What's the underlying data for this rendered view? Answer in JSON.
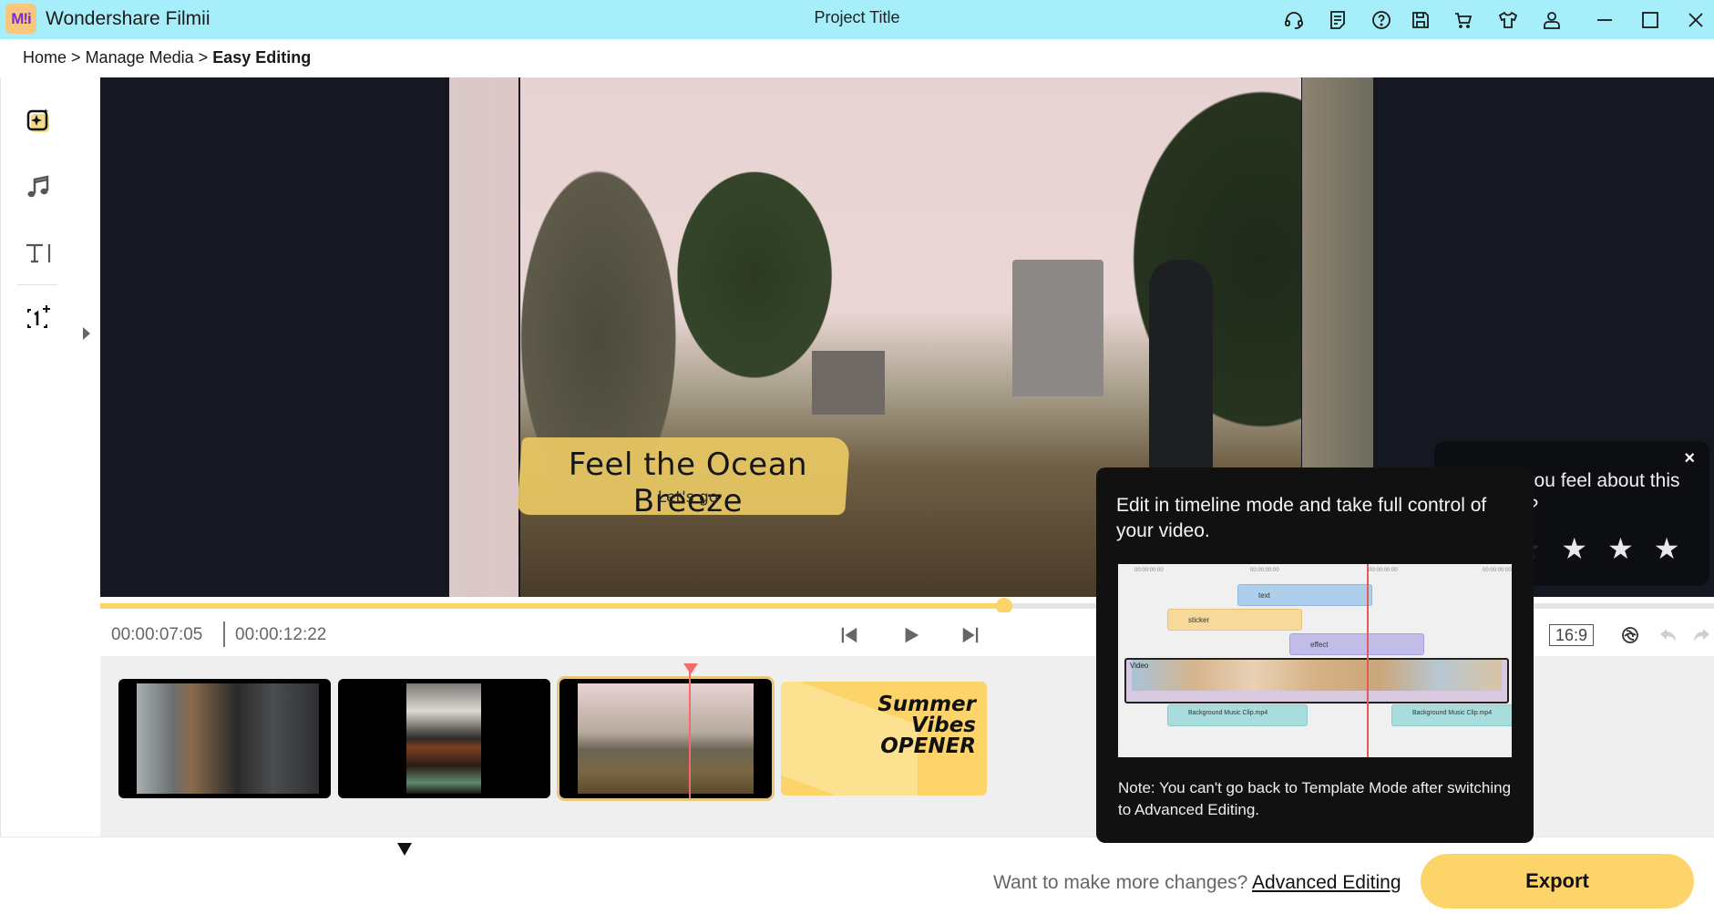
{
  "window": {
    "app_name": "Wondershare Filmii",
    "logo_text": "M!i",
    "project_title": "Project Title",
    "toolbar_icons": [
      "headset-icon",
      "notes-icon",
      "help-icon",
      "save-icon",
      "cart-icon",
      "tshirt-icon",
      "account-icon"
    ],
    "window_controls": [
      "minimize",
      "maximize",
      "close"
    ]
  },
  "breadcrumb": {
    "items": [
      "Home",
      "Manage Media"
    ],
    "separator": ">",
    "current": "Easy Editing"
  },
  "sidebar": {
    "items": [
      {
        "name": "templates",
        "icon": "sparkle-frame-icon",
        "active": true
      },
      {
        "name": "music",
        "icon": "music-note-icon",
        "active": false
      },
      {
        "name": "text",
        "icon": "text-icon",
        "active": false
      },
      {
        "name": "add-media",
        "icon": "add-clip-icon",
        "active": false
      }
    ]
  },
  "preview": {
    "caption_title": "Feel the Ocean Breeze",
    "caption_subtitle": "Let's go"
  },
  "playback": {
    "current_time": "00:00:07:05",
    "total_time": "00:00:12:22",
    "progress_fraction": 0.56,
    "aspect_ratio": "16:9"
  },
  "clips": [
    {
      "name": "couple-embrace-clip",
      "selected": false
    },
    {
      "name": "bookshelf-frame-clip",
      "selected": false
    },
    {
      "name": "cemetery-clip",
      "selected": true
    },
    {
      "name": "summer-vibes-opener-clip",
      "selected": false,
      "title": "Summer Vibes OPENER"
    }
  ],
  "rating": {
    "question": "How do you feel about this template?",
    "close": "×",
    "star_count": 5
  },
  "tooltip": {
    "title": "Edit in timeline mode and take full control of your video.",
    "note": "Note: You can't go back to Template Mode after switching to Advanced Editing.",
    "demo": {
      "tick": "00:00:00:00",
      "tracks": {
        "text": "text",
        "sticker": "sticker",
        "effect": "effect",
        "video": "Video",
        "audio": "Background Music Clip.mp4"
      }
    }
  },
  "footer": {
    "prompt": "Want to make more changes?",
    "link": "Advanced Editing",
    "export": "Export"
  },
  "colors": {
    "titlebar": "#a5eefa",
    "accent": "#fcd46a",
    "playhead": "#f26b6b",
    "preview_bg": "#151820"
  }
}
